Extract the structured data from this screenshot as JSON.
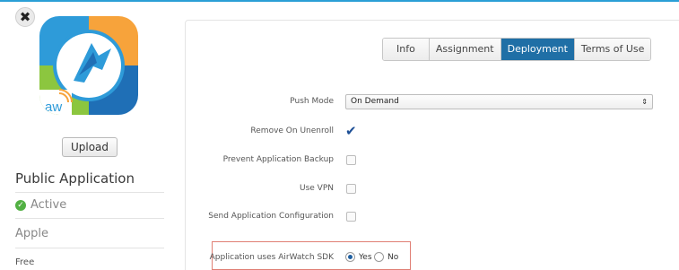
{
  "icons": {
    "close": "close-icon",
    "app_logo": "airwatch-logo-icon",
    "status": "check-circle-icon",
    "checkmark": "checkmark-icon",
    "select_arrows": "up-down-arrows-icon"
  },
  "colors": {
    "accent": "#2a9fd6",
    "active_tab": "#1f6fa6",
    "status_green": "#52b043",
    "highlight_border": "#e07f74"
  },
  "sidebar": {
    "close_glyph": "✖",
    "logo_text": "aw",
    "upload_label": "Upload",
    "app_name": "Public Application",
    "status": "Active",
    "platform": "Apple",
    "price": "Free"
  },
  "tabs": [
    "Info",
    "Assignment",
    "Deployment",
    "Terms of Use"
  ],
  "active_tab": "Deployment",
  "form": {
    "push_mode_label": "Push Mode",
    "push_mode_value": "On Demand",
    "remove_on_unenroll_label": "Remove On Unenroll",
    "remove_on_unenroll_checked": true,
    "prevent_backup_label": "Prevent Application Backup",
    "prevent_backup_checked": false,
    "use_vpn_label": "Use VPN",
    "use_vpn_checked": false,
    "send_config_label": "Send Application Configuration",
    "send_config_checked": false,
    "sdk_label": "Application uses AirWatch SDK",
    "sdk_yes": "Yes",
    "sdk_no": "No",
    "sdk_value": "Yes"
  }
}
